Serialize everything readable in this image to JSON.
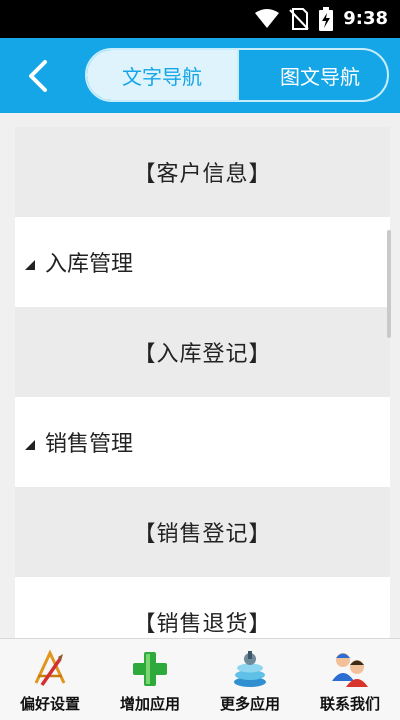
{
  "status_bar": {
    "time": "9:38",
    "icons": [
      "wifi-icon",
      "no-sim-icon",
      "battery-charging-icon"
    ]
  },
  "nav": {
    "back_icon": "chevron-left-icon",
    "tabs": [
      {
        "label": "文字导航",
        "active": true
      },
      {
        "label": "图文导航",
        "active": false
      }
    ],
    "accent_color": "#14a6e6"
  },
  "list": {
    "rows": [
      {
        "type": "item",
        "label": "【客户信息】"
      },
      {
        "type": "group",
        "label": "入库管理"
      },
      {
        "type": "item",
        "label": "【入库登记】"
      },
      {
        "type": "group",
        "label": "销售管理"
      },
      {
        "type": "item",
        "label": "【销售登记】"
      },
      {
        "type": "group",
        "label": "【销售退货】"
      }
    ]
  },
  "bottom_bar": {
    "items": [
      {
        "label": "偏好设置",
        "icon": "preferences-icon"
      },
      {
        "label": "增加应用",
        "icon": "add-app-icon"
      },
      {
        "label": "更多应用",
        "icon": "more-apps-icon"
      },
      {
        "label": "联系我们",
        "icon": "contact-us-icon"
      }
    ]
  }
}
